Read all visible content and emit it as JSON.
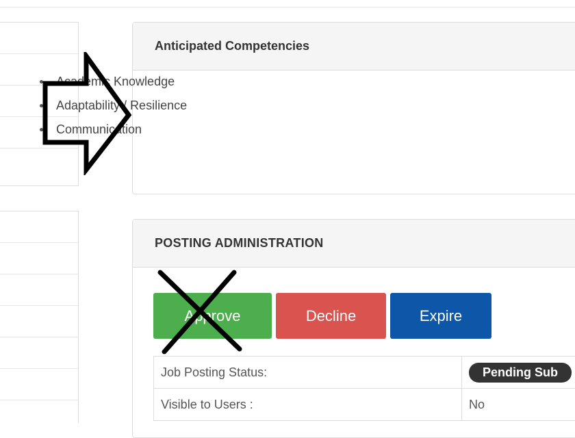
{
  "competencies_panel": {
    "title": "Anticipated Competencies",
    "items": [
      "Academic Knowledge",
      "Adaptability / Resilience",
      "Communication"
    ]
  },
  "posting_admin": {
    "title": "POSTING ADMINISTRATION",
    "buttons": {
      "approve": "Approve",
      "decline": "Decline",
      "expire": "Expire"
    },
    "rows": [
      {
        "label": "Job Posting Status:",
        "value": "Pending Sub"
      },
      {
        "label": "Visible to Users :",
        "value": "No"
      }
    ]
  },
  "colors": {
    "approve": "#4cae4c",
    "decline": "#d9534f",
    "expire": "#0d56a8",
    "badge": "#333333"
  },
  "annotations": {
    "arrow": "right-arrow-outline",
    "cross": "x-mark"
  }
}
